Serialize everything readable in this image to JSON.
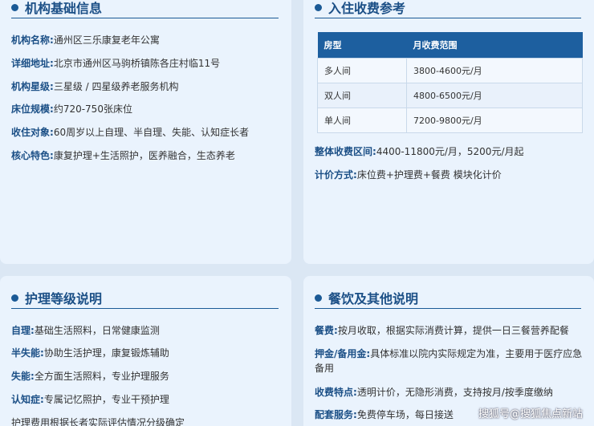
{
  "basic": {
    "title": "机构基础信息",
    "items": [
      {
        "label": "机构名称:",
        "value": "通州区三乐康复老年公寓"
      },
      {
        "label": "详细地址:",
        "value": "北京市通州区马驹桥镇陈各庄村临11号"
      },
      {
        "label": "机构星级:",
        "value": "三星级 / 四星级养老服务机构"
      },
      {
        "label": "床位规模:",
        "value": "约720-750张床位"
      },
      {
        "label": "收住对象:",
        "value": "60周岁以上自理、半自理、失能、认知症长者"
      },
      {
        "label": "核心特色:",
        "value": "康复护理+生活照护，医养融合，生态养老"
      }
    ]
  },
  "fees": {
    "title": "入住收费参考",
    "table": {
      "headers": [
        "房型",
        "月收费范围"
      ],
      "rows": [
        [
          "多人间",
          "3800-4600元/月"
        ],
        [
          "双人间",
          "4800-6500元/月"
        ],
        [
          "单人间",
          "7200-9800元/月"
        ]
      ]
    },
    "range_label": "整体收费区间:",
    "range_value": "4400-11800元/月，5200元/月起",
    "method_label": "计价方式:",
    "method_value": "床位费+护理费+餐费 模块化计价"
  },
  "care": {
    "title": "护理等级说明",
    "items": [
      {
        "label": "自理:",
        "value": "基础生活照料，日常健康监测"
      },
      {
        "label": "半失能:",
        "value": "协助生活护理，康复锻炼辅助"
      },
      {
        "label": "失能:",
        "value": "全方面生活照料，专业护理服务"
      },
      {
        "label": "认知症:",
        "value": "专属记忆照护，专业干预护理"
      }
    ],
    "note": "护理费用根据长者实际评估情况分级确定"
  },
  "food": {
    "title": "餐饮及其他说明",
    "items": [
      {
        "label": "餐费:",
        "value": "按月收取，根据实际消费计算，提供一日三餐营养配餐"
      },
      {
        "label": "押金/备用金:",
        "value": "具体标准以院内实际规定为准，主要用于医疗应急备用"
      },
      {
        "label": "收费特点:",
        "value": "透明计价，无隐形消费，支持按月/按季度缴纳"
      },
      {
        "label": "配套服务:",
        "value": "免费停车场，每日接送"
      }
    ]
  },
  "watermark": "搜狐号@搜狐焦点新站",
  "colors": {
    "accent": "#1b5a96",
    "card_bg": "#eaf3fd",
    "table_header": "#1d5f9f"
  }
}
